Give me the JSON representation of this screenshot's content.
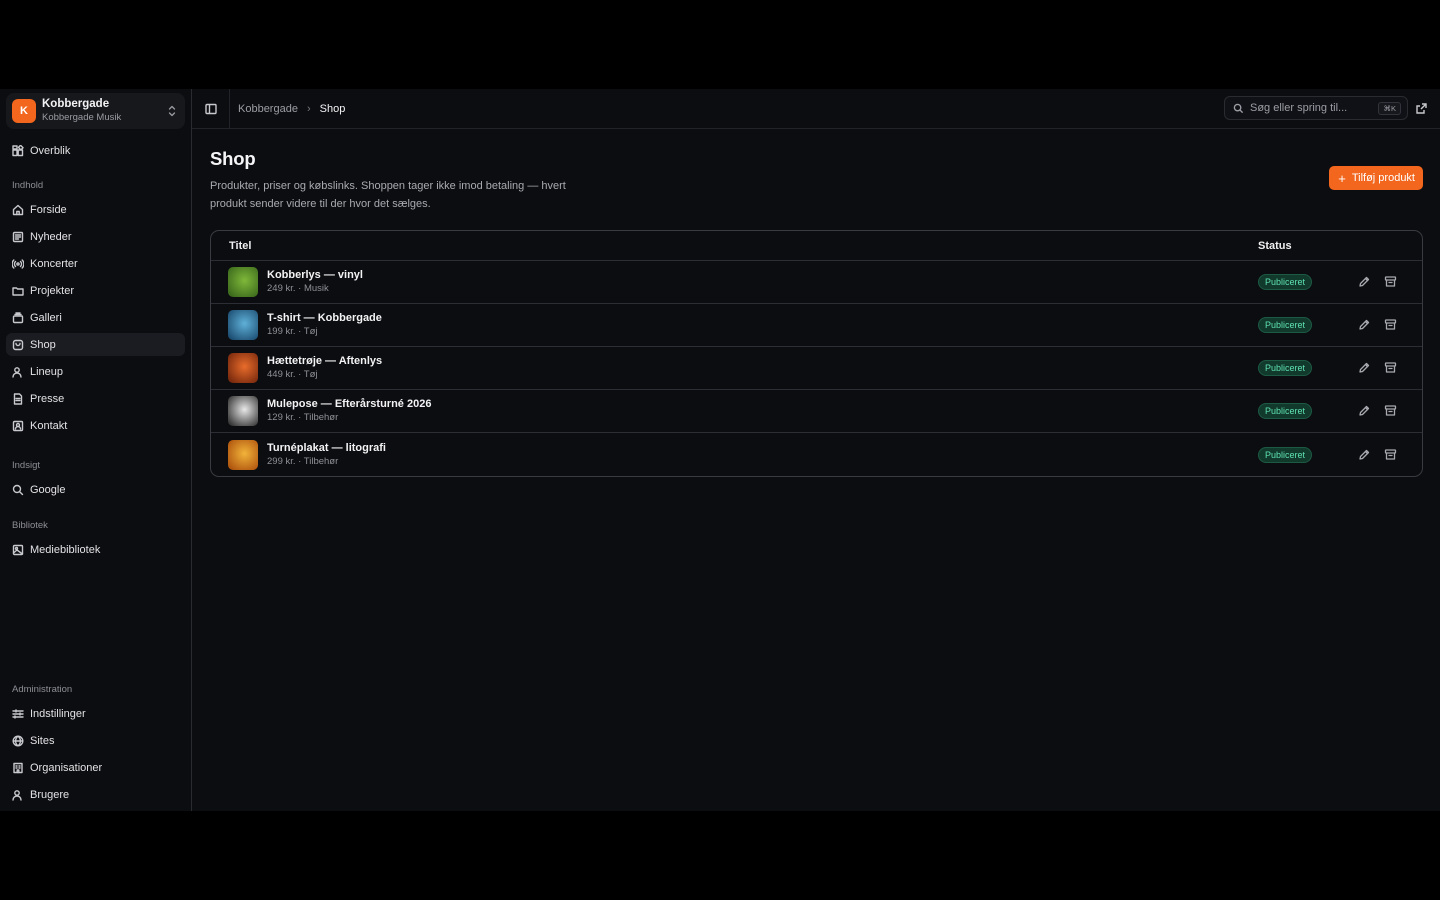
{
  "org": {
    "initial": "K",
    "name": "Kobbergade",
    "subtitle": "Kobbergade Musik"
  },
  "sidebar": {
    "top": [
      {
        "label": "Overblik",
        "icon": "overview-icon"
      }
    ],
    "sections": [
      {
        "title": "Indhold",
        "items": [
          {
            "label": "Forside",
            "icon": "home-icon"
          },
          {
            "label": "Nyheder",
            "icon": "newspaper-icon"
          },
          {
            "label": "Koncerter",
            "icon": "broadcast-icon"
          },
          {
            "label": "Projekter",
            "icon": "folder-icon"
          },
          {
            "label": "Galleri",
            "icon": "gallery-icon"
          },
          {
            "label": "Shop",
            "icon": "shop-icon",
            "active": true
          },
          {
            "label": "Lineup",
            "icon": "users-icon"
          },
          {
            "label": "Presse",
            "icon": "document-icon"
          },
          {
            "label": "Kontakt",
            "icon": "contact-icon"
          }
        ]
      },
      {
        "title": "Indsigt",
        "items": [
          {
            "label": "Google",
            "icon": "search-icon"
          }
        ]
      },
      {
        "title": "Bibliotek",
        "items": [
          {
            "label": "Mediebibliotek",
            "icon": "image-icon"
          }
        ]
      },
      {
        "title": "Administration",
        "items": [
          {
            "label": "Indstillinger",
            "icon": "sliders-icon"
          },
          {
            "label": "Sites",
            "icon": "globe-icon"
          },
          {
            "label": "Organisationer",
            "icon": "building-icon"
          },
          {
            "label": "Brugere",
            "icon": "users-icon"
          }
        ]
      }
    ]
  },
  "topbar": {
    "breadcrumb_root": "Kobbergade",
    "breadcrumb_sep": "›",
    "breadcrumb_current": "Shop",
    "search_placeholder": "Søg eller spring til...",
    "search_shortcut": "⌘K"
  },
  "page": {
    "title": "Shop",
    "description": "Produkter, priser og købslinks. Shoppen tager ikke imod betaling — hvert produkt sender videre til der hvor det sælges.",
    "add_button": "Tilføj produkt"
  },
  "table": {
    "headers": {
      "title": "Titel",
      "status": "Status"
    },
    "rows": [
      {
        "title": "Kobberlys — vinyl",
        "meta": "249 kr. · Musik",
        "status": "Publiceret",
        "thumb_colors": [
          "#7fb83a",
          "#3d6b1d"
        ]
      },
      {
        "title": "T-shirt — Kobbergade",
        "meta": "199 kr. · Tøj",
        "status": "Publiceret",
        "thumb_colors": [
          "#5fb0d8",
          "#1e4f74"
        ]
      },
      {
        "title": "Hættetrøje — Aftenlys",
        "meta": "449 kr. · Tøj",
        "status": "Publiceret",
        "thumb_colors": [
          "#e86c2b",
          "#7a2a0e"
        ]
      },
      {
        "title": "Mulepose — Efterårsturné 2026",
        "meta": "129 kr. · Tilbehør",
        "status": "Publiceret",
        "thumb_colors": [
          "#e8e8e8",
          "#3a3a3a"
        ]
      },
      {
        "title": "Turnéplakat — litografi",
        "meta": "299 kr. · Tilbehør",
        "status": "Publiceret",
        "thumb_colors": [
          "#f2b33a",
          "#b0560f"
        ]
      }
    ]
  },
  "colors": {
    "accent": "#f2661d",
    "badge_text": "#5fe2b3",
    "badge_bg": "#113a2c"
  }
}
